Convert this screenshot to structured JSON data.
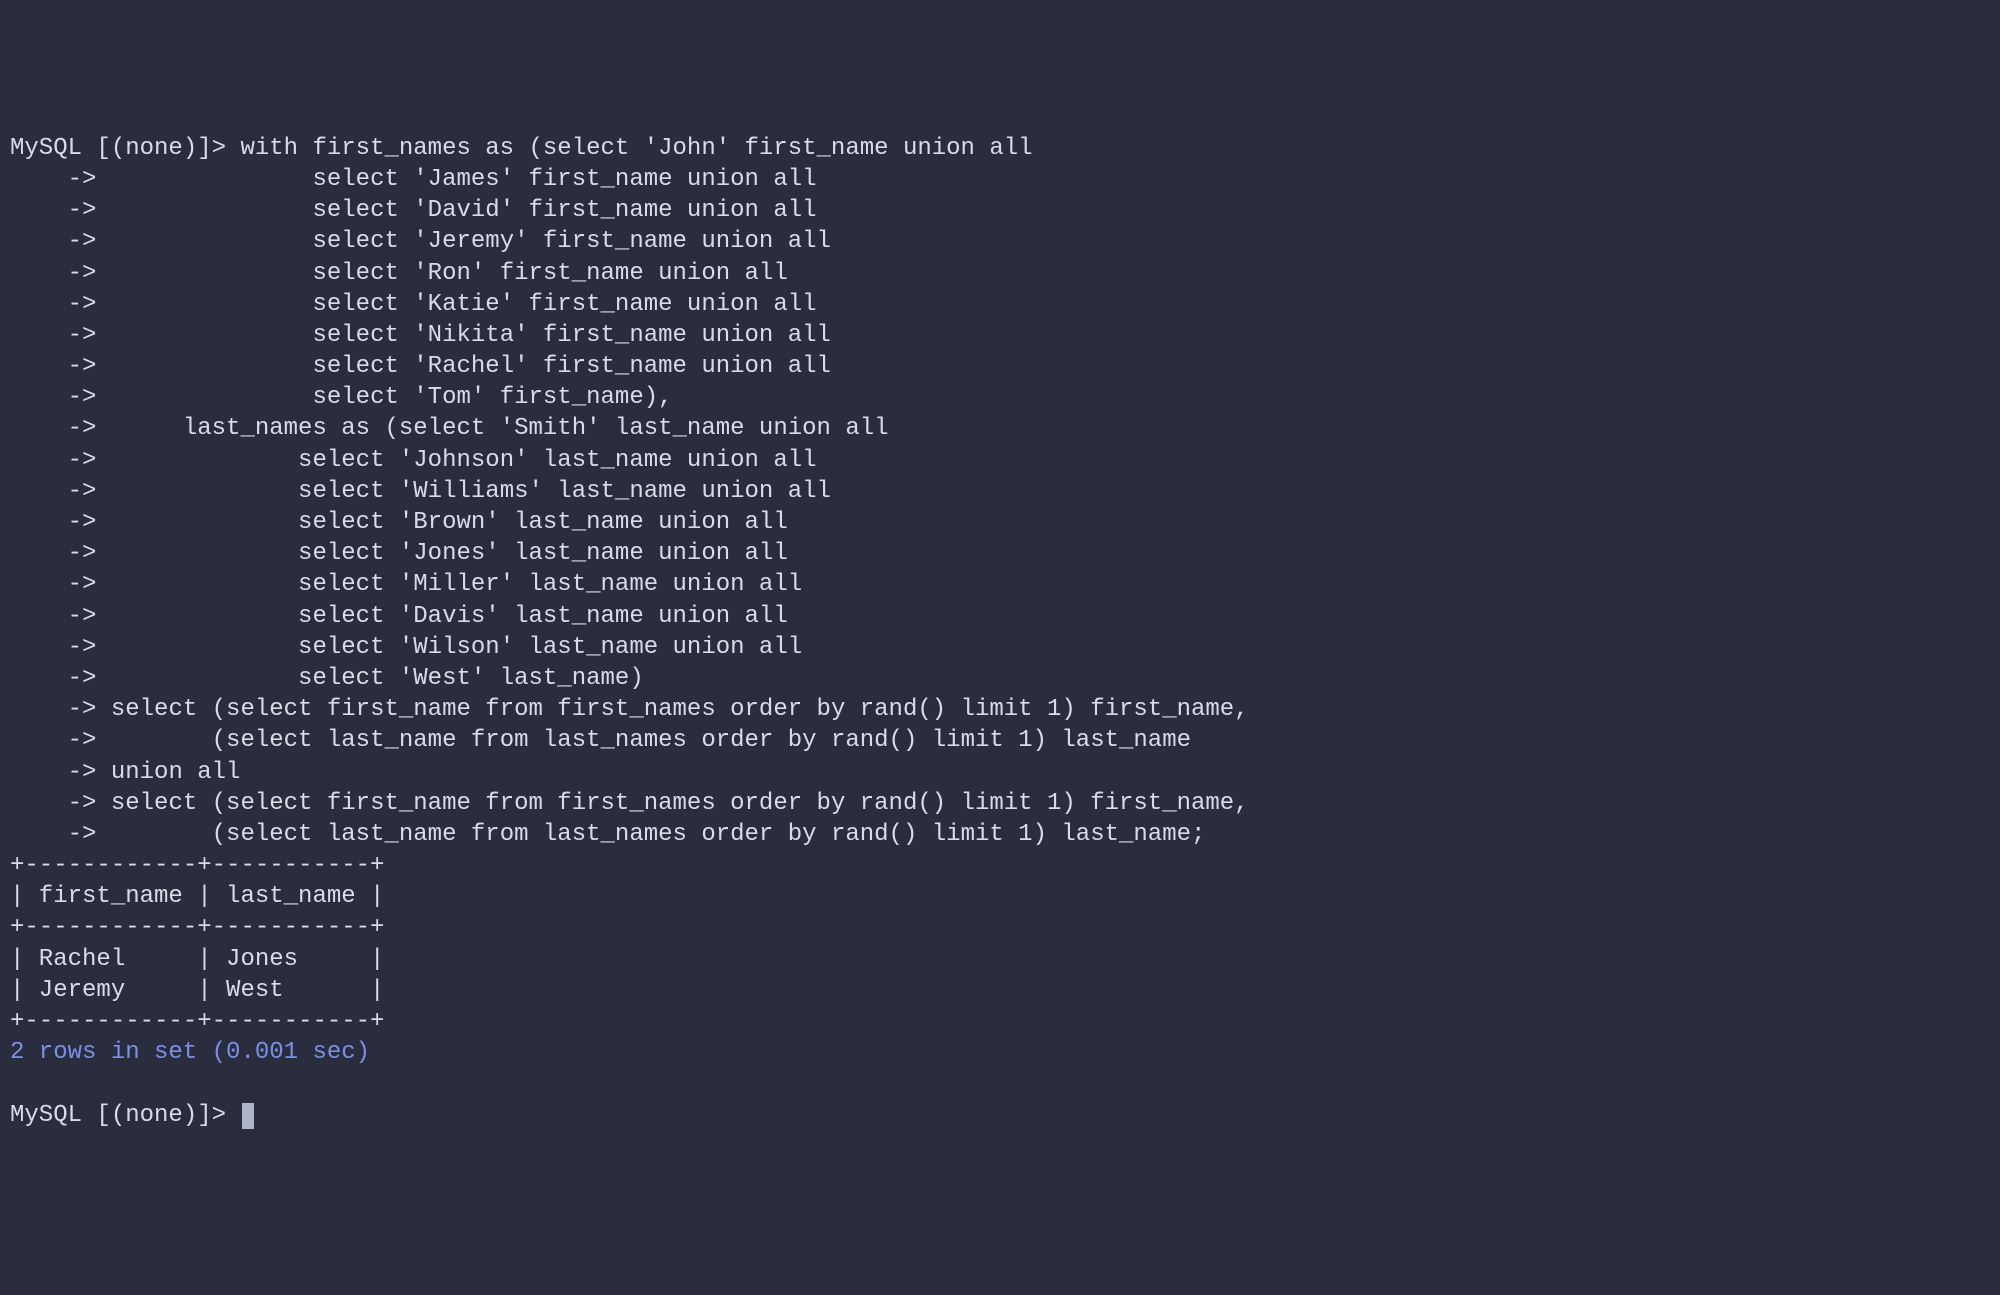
{
  "prompt": "MySQL [(none)]> ",
  "continuation": "    -> ",
  "query": {
    "line1": "with first_names as (select 'John' first_name union all",
    "line2": "              select 'James' first_name union all",
    "line3": "              select 'David' first_name union all",
    "line4": "              select 'Jeremy' first_name union all",
    "line5": "              select 'Ron' first_name union all",
    "line6": "              select 'Katie' first_name union all",
    "line7": "              select 'Nikita' first_name union all",
    "line8": "              select 'Rachel' first_name union all",
    "line9": "              select 'Tom' first_name),",
    "line10": "     last_names as (select 'Smith' last_name union all",
    "line11": "             select 'Johnson' last_name union all",
    "line12": "             select 'Williams' last_name union all",
    "line13": "             select 'Brown' last_name union all",
    "line14": "             select 'Jones' last_name union all",
    "line15": "             select 'Miller' last_name union all",
    "line16": "             select 'Davis' last_name union all",
    "line17": "             select 'Wilson' last_name union all",
    "line18": "             select 'West' last_name)",
    "line19": "select (select first_name from first_names order by rand() limit 1) first_name,",
    "line20": "       (select last_name from last_names order by rand() limit 1) last_name",
    "line21": "union all",
    "line22": "select (select first_name from first_names order by rand() limit 1) first_name,",
    "line23": "       (select last_name from last_names order by rand() limit 1) last_name;"
  },
  "table": {
    "border_top": "+------------+-----------+",
    "header": "| first_name | last_name |",
    "border_mid": "+------------+-----------+",
    "row1": "| Rachel     | Jones     |",
    "row2": "| Jeremy     | West      |",
    "border_bottom": "+------------+-----------+"
  },
  "summary": "2 rows in set (0.001 sec)",
  "final_prompt": "MySQL [(none)]> ",
  "chart_data": {
    "type": "table",
    "columns": [
      "first_name",
      "last_name"
    ],
    "rows": [
      [
        "Rachel",
        "Jones"
      ],
      [
        "Jeremy",
        "West"
      ]
    ]
  }
}
